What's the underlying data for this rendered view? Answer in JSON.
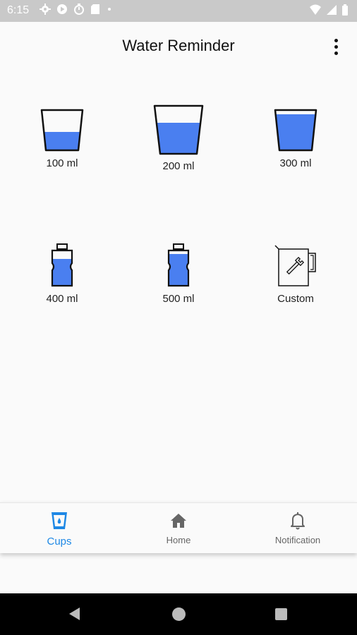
{
  "status_bar": {
    "time": "6:15"
  },
  "app_bar": {
    "title": "Water Reminder"
  },
  "cups": [
    {
      "label": "100 ml",
      "icon": "glass-small-icon",
      "fill": 0.4
    },
    {
      "label": "200 ml",
      "icon": "glass-medium-icon",
      "fill": 0.65
    },
    {
      "label": "300 ml",
      "icon": "glass-full-icon",
      "fill": 0.9
    },
    {
      "label": "400 ml",
      "icon": "bottle-icon",
      "fill": 0.7
    },
    {
      "label": "500 ml",
      "icon": "bottle-full-icon",
      "fill": 0.85
    },
    {
      "label": "Custom",
      "icon": "jug-wrench-icon"
    }
  ],
  "bottom_nav": {
    "cups": "Cups",
    "home": "Home",
    "notification": "Notification"
  },
  "colors": {
    "water": "#4a7ff0",
    "accent": "#1e88e5"
  }
}
